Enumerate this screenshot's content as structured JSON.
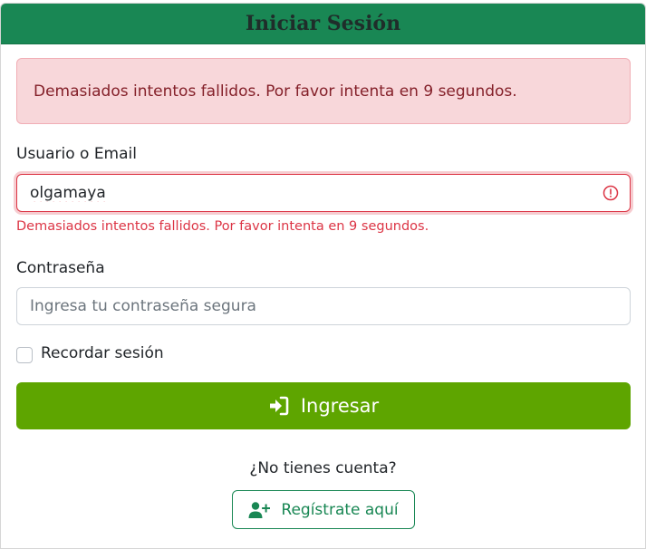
{
  "header": {
    "title": "Iniciar Sesión"
  },
  "alert": {
    "message": "Demasiados intentos fallidos. Por favor intenta en 9 segundos."
  },
  "form": {
    "username": {
      "label": "Usuario o Email",
      "value": "olgamaya",
      "error": "Demasiados intentos fallidos. Por favor intenta en 9 segundos.",
      "error_icon": "exclamation-circle-icon"
    },
    "password": {
      "label": "Contraseña",
      "value": "",
      "placeholder": "Ingresa tu contraseña segura"
    },
    "remember": {
      "label": "Recordar sesión",
      "checked": false
    },
    "submit": {
      "label": "Ingresar",
      "icon": "sign-in-icon"
    }
  },
  "footer": {
    "prompt": "¿No tienes cuenta?",
    "register_label": "Regístrate aquí",
    "register_icon": "user-plus-icon"
  },
  "colors": {
    "header_bg": "#198754",
    "alert_bg": "#f8d7da",
    "alert_text": "#842029",
    "error": "#dc3545",
    "primary_button": "#5ea500",
    "register_outline": "#198754"
  }
}
